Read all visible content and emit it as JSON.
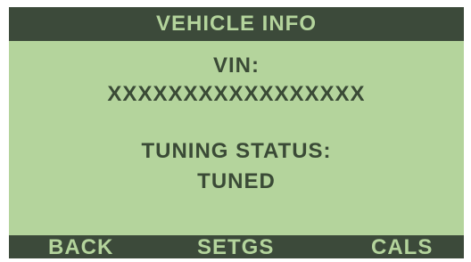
{
  "header": {
    "title": "VEHICLE INFO"
  },
  "vehicle": {
    "vin_label": "VIN:",
    "vin_value": "XXXXXXXXXXXXXXXXX",
    "tuning_status_label": "TUNING STATUS:",
    "tuning_status_value": "TUNED"
  },
  "softkeys": {
    "left": "BACK",
    "middle": "SETGS",
    "right": "CALS"
  },
  "colors": {
    "screen_background": "#b4d49c",
    "bar_background": "#3c4a3a",
    "text_dark": "#3a4a36"
  }
}
